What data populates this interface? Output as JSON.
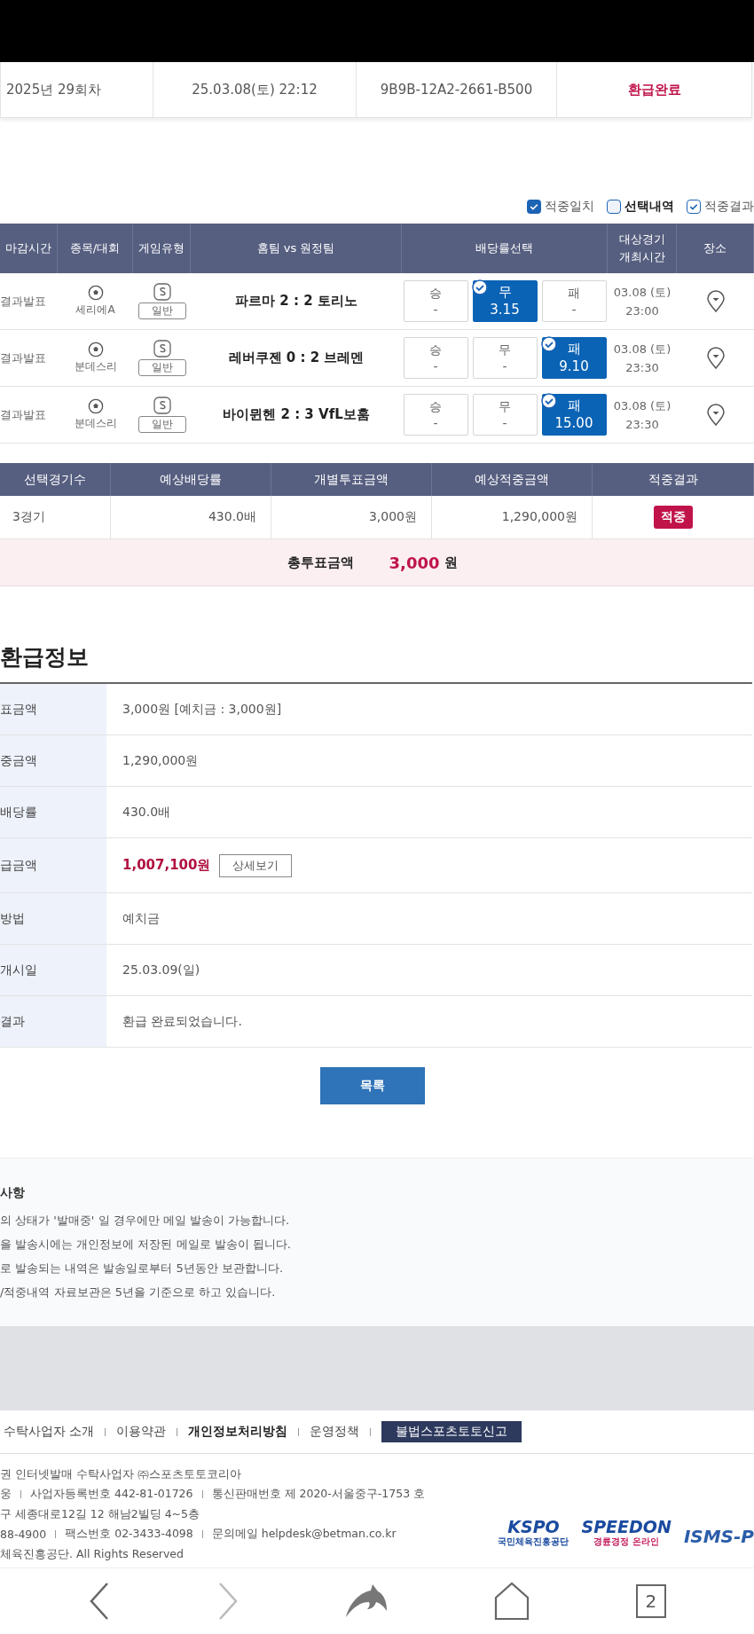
{
  "purchase_info": [
    {
      "value": "2025년 29회차",
      "kind": "text"
    },
    {
      "value": "25.03.08(토) 22:12",
      "kind": "text"
    },
    {
      "value": "9B9B-12A2-2661-B500",
      "kind": "text"
    },
    {
      "value": "환급완료",
      "kind": "status"
    }
  ],
  "legend": [
    {
      "label": "적중일치",
      "checked": true,
      "kind": "solid"
    },
    {
      "label": "선택내역",
      "checked": false,
      "kind": "solid"
    },
    {
      "label": "적중결과",
      "checked": true,
      "kind": "outline"
    }
  ],
  "match_table": {
    "columns": [
      [
        "마감시간"
      ],
      [
        "종목/대회"
      ],
      [
        "게임유형"
      ],
      [
        "홈팀 vs 원정팀"
      ],
      [
        "배당률선택"
      ],
      [
        "대상경기",
        "개최시간"
      ],
      [
        "장소"
      ]
    ],
    "rows": [
      {
        "deadline": "결과발표",
        "league": "세리에A",
        "game_type": "일반",
        "match": "파르마 2 : 2 토리노",
        "options": [
          {
            "label": "승",
            "odds": "-",
            "selected": false
          },
          {
            "label": "무",
            "odds": "3.15",
            "selected": true
          },
          {
            "label": "패",
            "odds": "-",
            "selected": false
          }
        ],
        "date": "03.08 (토)",
        "time": "23:00"
      },
      {
        "deadline": "결과발표",
        "league": "분데스리",
        "game_type": "일반",
        "match": "레버쿠젠 0 : 2 브레멘",
        "options": [
          {
            "label": "승",
            "odds": "-",
            "selected": false
          },
          {
            "label": "무",
            "odds": "-",
            "selected": false
          },
          {
            "label": "패",
            "odds": "9.10",
            "selected": true
          }
        ],
        "date": "03.08 (토)",
        "time": "23:30"
      },
      {
        "deadline": "결과발표",
        "league": "분데스리",
        "game_type": "일반",
        "match": "바이뮌헨 2 : 3 VfL보훔",
        "options": [
          {
            "label": "승",
            "odds": "-",
            "selected": false
          },
          {
            "label": "무",
            "odds": "-",
            "selected": false
          },
          {
            "label": "패",
            "odds": "15.00",
            "selected": true
          }
        ],
        "date": "03.08 (토)",
        "time": "23:30"
      }
    ]
  },
  "summary": {
    "columns": [
      "선택경기수",
      "예상배당률",
      "개별투표금액",
      "예상적중금액",
      "적중결과"
    ],
    "values": [
      "3경기",
      "430.0배",
      "3,000원",
      "1,290,000원"
    ],
    "result": "적중",
    "total_label": "총투표금액",
    "total_amount": "3,000",
    "total_unit": "원"
  },
  "refund": {
    "title": "환급정보",
    "rows": [
      {
        "label": "표금액",
        "value": "3,000원 [예치금 : 3,000원]",
        "kind": "text"
      },
      {
        "label": "중금액",
        "value": "1,290,000원",
        "kind": "text"
      },
      {
        "label": "배당률",
        "value": "430.0배",
        "kind": "text"
      },
      {
        "label": "급금액",
        "value": "1,007,100원",
        "kind": "amount",
        "button": "상세보기"
      },
      {
        "label": "방법",
        "value": "예치금",
        "kind": "text"
      },
      {
        "label": "개시일",
        "value": "25.03.09(일)",
        "kind": "text"
      },
      {
        "label": "결과",
        "value": "환급 완료되었습니다.",
        "kind": "text"
      }
    ],
    "list_button": "목록"
  },
  "notes": {
    "title": "사항",
    "lines": [
      "의 상태가 '발매중' 일 경우에만 메일 발송이 가능합니다.",
      "을 발송시에는 개인정보에 저장된 메일로 발송이 됩니다.",
      "로 발송되는 내역은 발송일로부터 5년동안 보관합니다.",
      "/적중내역 자료보관은 5년을 기준으로 하고 있습니다."
    ]
  },
  "footer": {
    "links": [
      {
        "label": "수탁사업자 소개",
        "kind": "link"
      },
      {
        "label": "이용약관",
        "kind": "link"
      },
      {
        "label": "개인정보처리방침",
        "kind": "bold"
      },
      {
        "label": "운영정책",
        "kind": "link"
      },
      {
        "label": "불법스포츠토토신고",
        "kind": "button"
      }
    ],
    "lines": [
      [
        "권 인터넷발매 수탁사업자 ㈜스포츠토토코리아"
      ],
      [
        "웅",
        "사업자등록번호 442-81-01726",
        "통신판매번호 제 2020-서울중구-1753 호"
      ],
      [
        "구 세종대로12길 12 해남2빌딩 4~5층"
      ],
      [
        "88-4900",
        "팩스번호 02-3433-4098",
        "문의메일 helpdesk@betman.co.kr"
      ],
      [
        "체육진흥공단. All Rights Reserved"
      ]
    ],
    "logos": [
      {
        "name": "KSPO",
        "sub": "국민체육진흥공단"
      },
      {
        "name": "SPEEDON",
        "sub": "경륜경정 온라인"
      },
      {
        "name": "ISMS-P"
      }
    ]
  },
  "nav_bar": {
    "tab_count": "2"
  }
}
